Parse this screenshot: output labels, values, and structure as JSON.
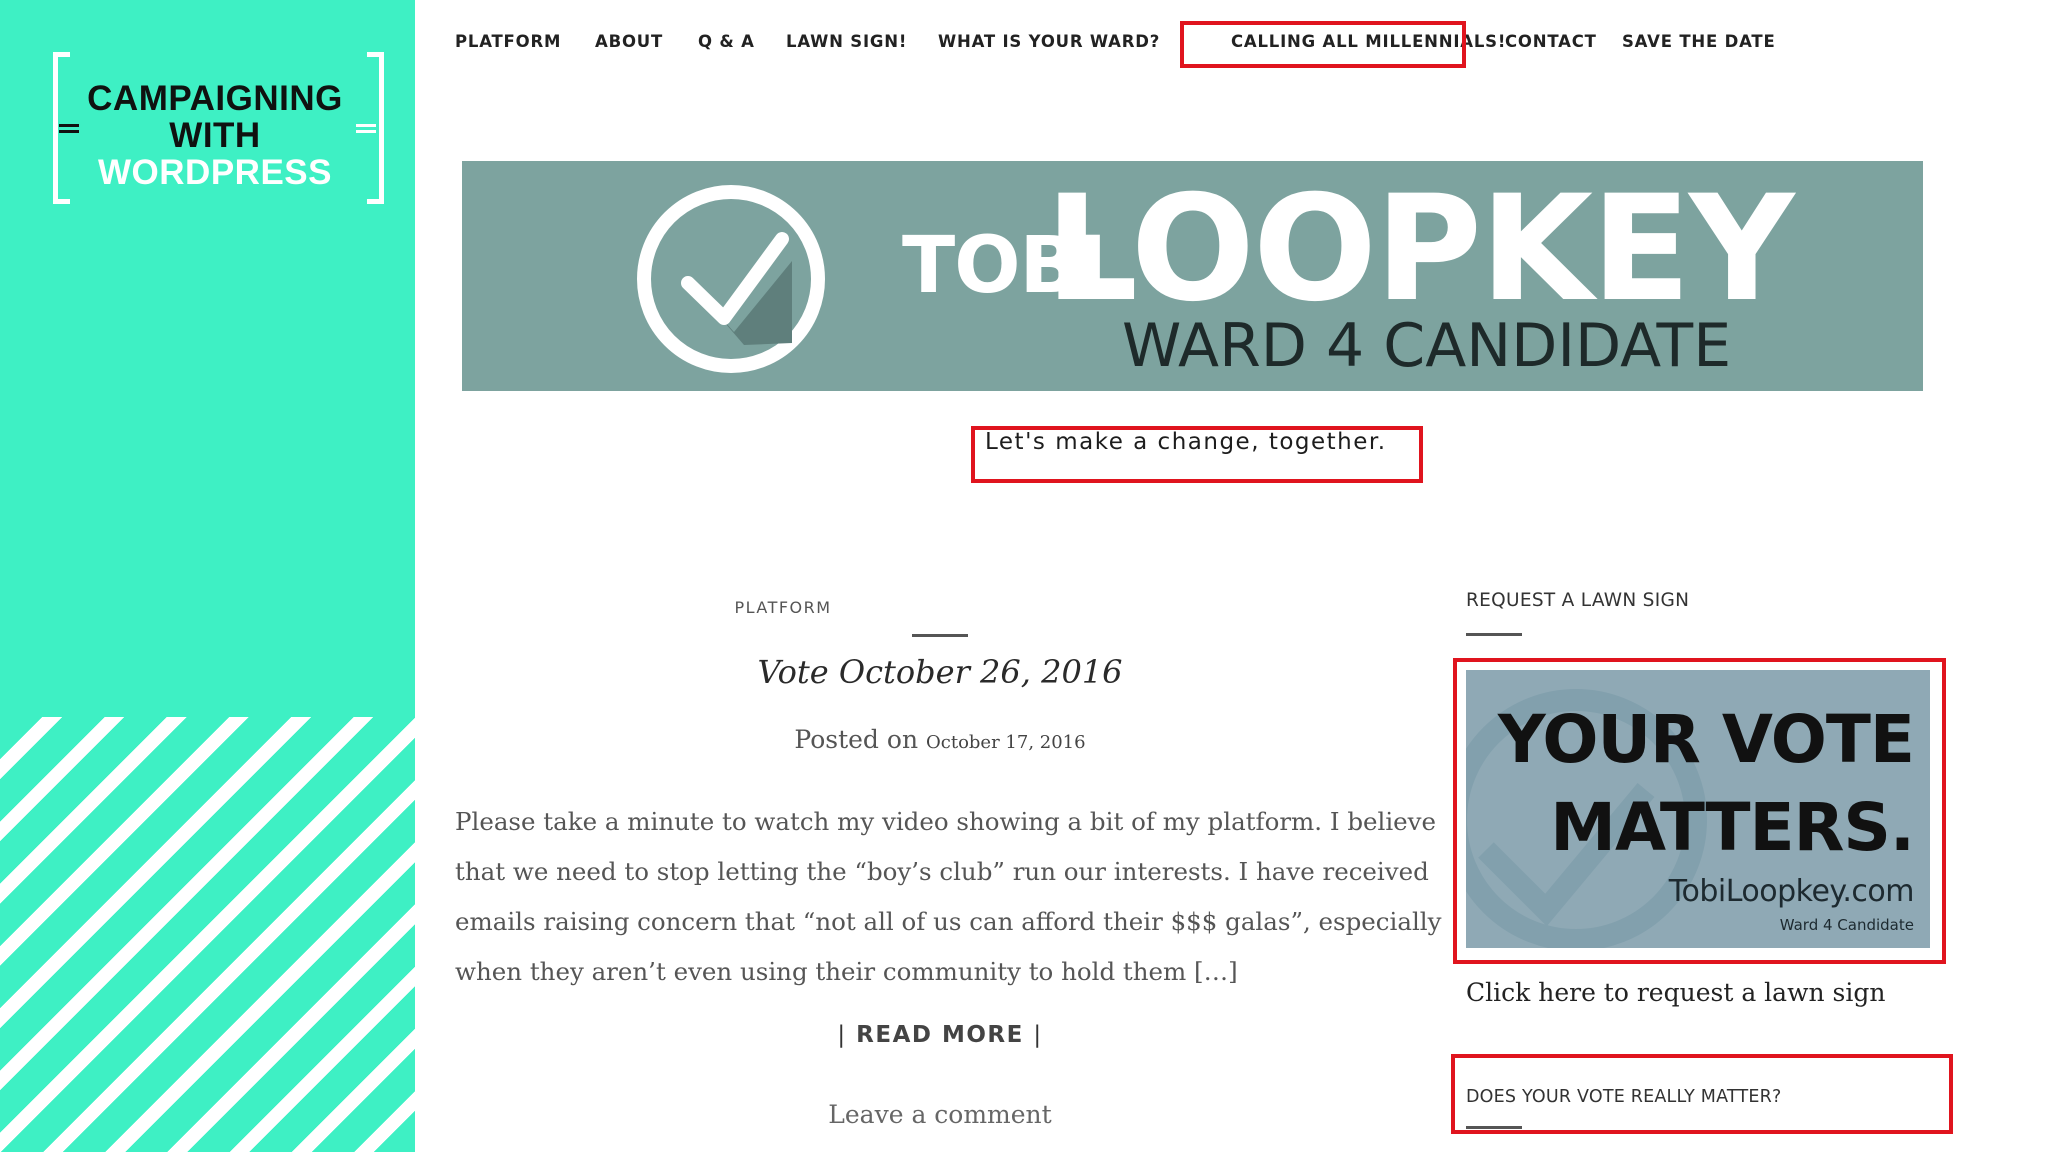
{
  "branding": {
    "line1": "CAMPAIGNING",
    "line2": "WITH",
    "line3": "WORDPRESS",
    "accent_color": "#3ef0c4"
  },
  "nav": {
    "items": [
      {
        "label": "PLATFORM"
      },
      {
        "label": "ABOUT"
      },
      {
        "label": "Q & A"
      },
      {
        "label": "LAWN SIGN!"
      },
      {
        "label": "WHAT IS YOUR WARD?"
      },
      {
        "label": "CALLING ALL MILLENNIALS!",
        "highlighted": true
      },
      {
        "label": "CONTACT"
      },
      {
        "label": "SAVE THE DATE"
      }
    ]
  },
  "header": {
    "first_name": "TOBI",
    "last_name": "LOOPKEY",
    "subtitle": "WARD 4 CANDIDATE",
    "tagline": "Let's make a change, together.",
    "banner_color": "#7da39f",
    "logo_icon": "checkmark-circle-icon"
  },
  "post": {
    "category": "PLATFORM",
    "title": "Vote October 26, 2016",
    "posted_prefix": "Posted on",
    "posted_date": "October 17, 2016",
    "excerpt": "Please take a minute to watch my video showing a bit of my platform. I believe that we need to stop letting the “boy’s club” run our interests. I have received emails raising concern that “not all of us can afford their $$$ galas”, especially when they aren’t even using their community to hold them […]",
    "read_more": "READ MORE",
    "comment_link": "Leave a comment"
  },
  "sidebar": {
    "lawn_widget_title": "REQUEST A LAWN SIGN",
    "lawn_sign": {
      "line1": "YOUR VOTE",
      "line2": "MATTERS.",
      "url": "TobiLoopkey.com",
      "ward": "Ward 4 Candidate"
    },
    "lawn_link": "Click here to request a lawn sign",
    "second_widget_title": "DOES YOUR VOTE REALLY MATTER?"
  },
  "highlight_color": "#e0141e"
}
